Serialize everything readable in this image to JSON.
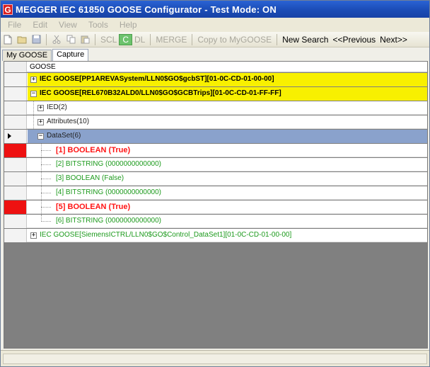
{
  "window": {
    "title": "MEGGER   IEC 61850 GOOSE Configurator - Test Mode: ON",
    "logo_letter": "G"
  },
  "menu": [
    "File",
    "Edit",
    "View",
    "Tools",
    "Help"
  ],
  "toolbar": {
    "icons": [
      "new-file-icon",
      "open-folder-icon",
      "save-icon",
      "cut-icon",
      "copy-icon",
      "paste-icon"
    ],
    "scl_label": "SCL",
    "c_label": "C",
    "dl_label": "DL",
    "merge_label": "MERGE",
    "copy_label": "Copy to MyGOOSE",
    "new_search_label": "New Search",
    "previous_label": "<<Previous",
    "next_label": "Next>>"
  },
  "tabs": [
    {
      "label": "My GOOSE",
      "active": false
    },
    {
      "label": "Capture",
      "active": true
    }
  ],
  "grid": {
    "column_header": "GOOSE",
    "rows": [
      {
        "text": "IEC GOOSE[PP1AREVASystem/LLN0$GO$gcbST][01-0C-CD-01-00-00]",
        "expander": "+"
      },
      {
        "text": "IEC GOOSE[REL670B32ALD0/LLN0$GO$GCBTrips][01-0C-CD-01-FF-FF]",
        "expander": "−"
      },
      {
        "text": "IED(2)",
        "expander": "+"
      },
      {
        "text": "Attributes(10)",
        "expander": "+"
      },
      {
        "text": "DataSet(6)",
        "expander": "−"
      },
      {
        "text": "[1] BOOLEAN   (True)"
      },
      {
        "text": "[2] BITSTRING   (0000000000000)"
      },
      {
        "text": "[3] BOOLEAN   (False)"
      },
      {
        "text": "[4] BITSTRING   (0000000000000)"
      },
      {
        "text": "[5] BOOLEAN   (True)"
      },
      {
        "text": "[6] BITSTRING   (0000000000000)"
      },
      {
        "text": "IEC GOOSE[SiemensICTRL/LLN0$GO$Control_DataSet1][01-0C-CD-01-00-00]",
        "expander": "+"
      }
    ]
  },
  "colors": {
    "title_bar": "#1b4cb6",
    "highlight_yellow": "#f8f000",
    "selected_row_blue": "#8aa2cc",
    "alarm_red": "#ee1111",
    "value_green": "#1c9a1c"
  }
}
